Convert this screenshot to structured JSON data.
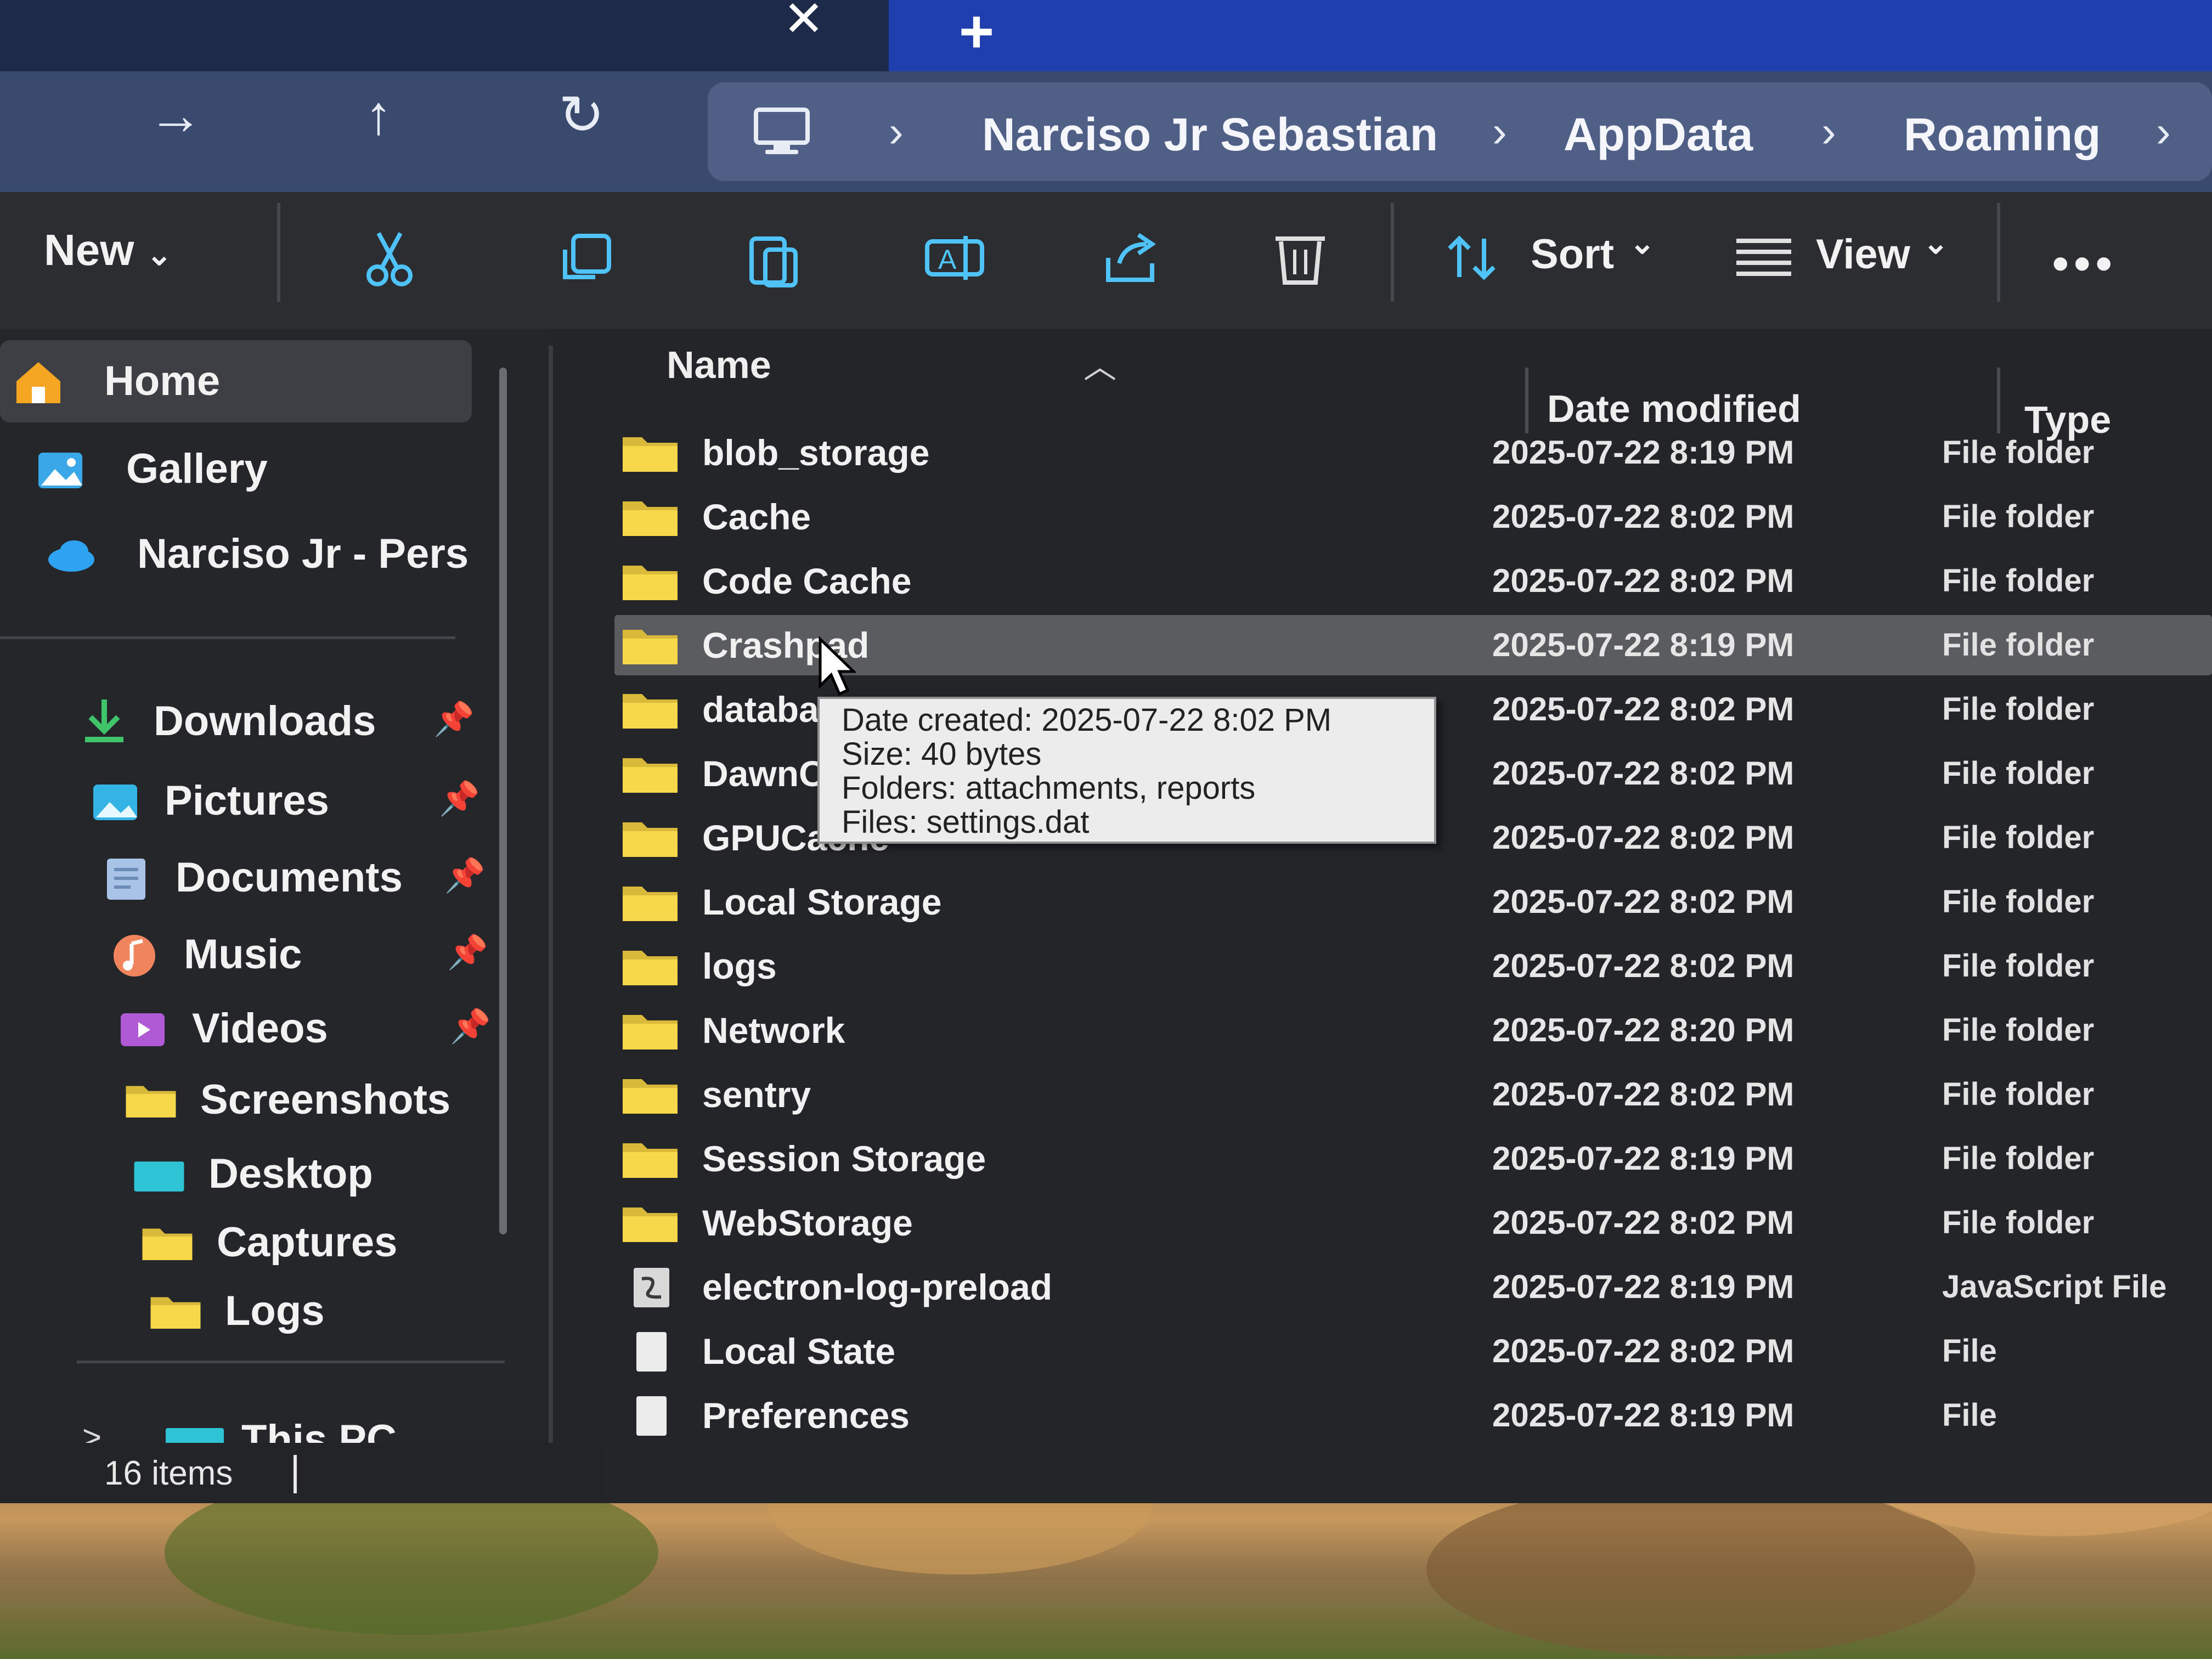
{
  "tabs": {
    "close_symbol": "✕",
    "add_symbol": "+"
  },
  "nav": {
    "forward_icon": "→",
    "up_icon": "↑",
    "refresh_icon": "↻",
    "breadcrumb": [
      "Narciso Jr Sebastian",
      "AppData",
      "Roaming"
    ],
    "separator": "›"
  },
  "command_bar": {
    "new_label": "New",
    "sort_label": "Sort",
    "view_label": "View",
    "more_label": "•••"
  },
  "sidebar": {
    "top_items": [
      {
        "label": "Home",
        "icon": "home-icon"
      },
      {
        "label": "Gallery",
        "icon": "gallery-icon"
      },
      {
        "label": "Narciso Jr - Pers",
        "icon": "onedrive-icon"
      }
    ],
    "quick_access": [
      {
        "label": "Downloads",
        "icon": "download-icon",
        "pinned": true
      },
      {
        "label": "Pictures",
        "icon": "pictures-icon",
        "pinned": true
      },
      {
        "label": "Documents",
        "icon": "documents-icon",
        "pinned": true
      },
      {
        "label": "Music",
        "icon": "music-icon",
        "pinned": true
      },
      {
        "label": "Videos",
        "icon": "videos-icon",
        "pinned": true
      },
      {
        "label": "Screenshots",
        "icon": "folder-icon",
        "pinned": false
      },
      {
        "label": "Desktop",
        "icon": "desktop-icon",
        "pinned": false
      },
      {
        "label": "Captures",
        "icon": "folder-icon",
        "pinned": false
      },
      {
        "label": "Logs",
        "icon": "folder-icon",
        "pinned": false
      }
    ],
    "this_pc_label": "This PC",
    "expand_symbol": ">"
  },
  "columns": {
    "name": "Name",
    "date": "Date modified",
    "type": "Type"
  },
  "files": [
    {
      "name": "blob_storage",
      "date": "2025-07-22 8:19 PM",
      "type": "File folder",
      "kind": "folder"
    },
    {
      "name": "Cache",
      "date": "2025-07-22 8:02 PM",
      "type": "File folder",
      "kind": "folder"
    },
    {
      "name": "Code Cache",
      "date": "2025-07-22 8:02 PM",
      "type": "File folder",
      "kind": "folder"
    },
    {
      "name": "Crashpad",
      "date": "2025-07-22 8:19 PM",
      "type": "File folder",
      "kind": "folder"
    },
    {
      "name": "databases",
      "date": "2025-07-22 8:02 PM",
      "type": "File folder",
      "kind": "folder"
    },
    {
      "name": "DawnCache",
      "date": "2025-07-22 8:02 PM",
      "type": "File folder",
      "kind": "folder"
    },
    {
      "name": "GPUCache",
      "date": "2025-07-22 8:02 PM",
      "type": "File folder",
      "kind": "folder"
    },
    {
      "name": "Local Storage",
      "date": "2025-07-22 8:02 PM",
      "type": "File folder",
      "kind": "folder"
    },
    {
      "name": "logs",
      "date": "2025-07-22 8:02 PM",
      "type": "File folder",
      "kind": "folder"
    },
    {
      "name": "Network",
      "date": "2025-07-22 8:20 PM",
      "type": "File folder",
      "kind": "folder"
    },
    {
      "name": "sentry",
      "date": "2025-07-22 8:02 PM",
      "type": "File folder",
      "kind": "folder"
    },
    {
      "name": "Session Storage",
      "date": "2025-07-22 8:19 PM",
      "type": "File folder",
      "kind": "folder"
    },
    {
      "name": "WebStorage",
      "date": "2025-07-22 8:02 PM",
      "type": "File folder",
      "kind": "folder"
    },
    {
      "name": "electron-log-preload",
      "date": "2025-07-22 8:19 PM",
      "type": "JavaScript File",
      "kind": "js"
    },
    {
      "name": "Local State",
      "date": "2025-07-22 8:02 PM",
      "type": "File",
      "kind": "file"
    },
    {
      "name": "Preferences",
      "date": "2025-07-22 8:19 PM",
      "type": "File",
      "kind": "file"
    }
  ],
  "selected_index": 3,
  "tooltip": {
    "lines": [
      "Date created: 2025-07-22 8:02 PM",
      "Size: 40 bytes",
      "Folders: attachments, reports",
      "Files: settings.dat"
    ]
  },
  "status": {
    "item_count": "16 items"
  },
  "colors": {
    "folder": "#f6d84a",
    "accent_tab": "#1f3fae",
    "selected_row": "#5b5c60"
  }
}
